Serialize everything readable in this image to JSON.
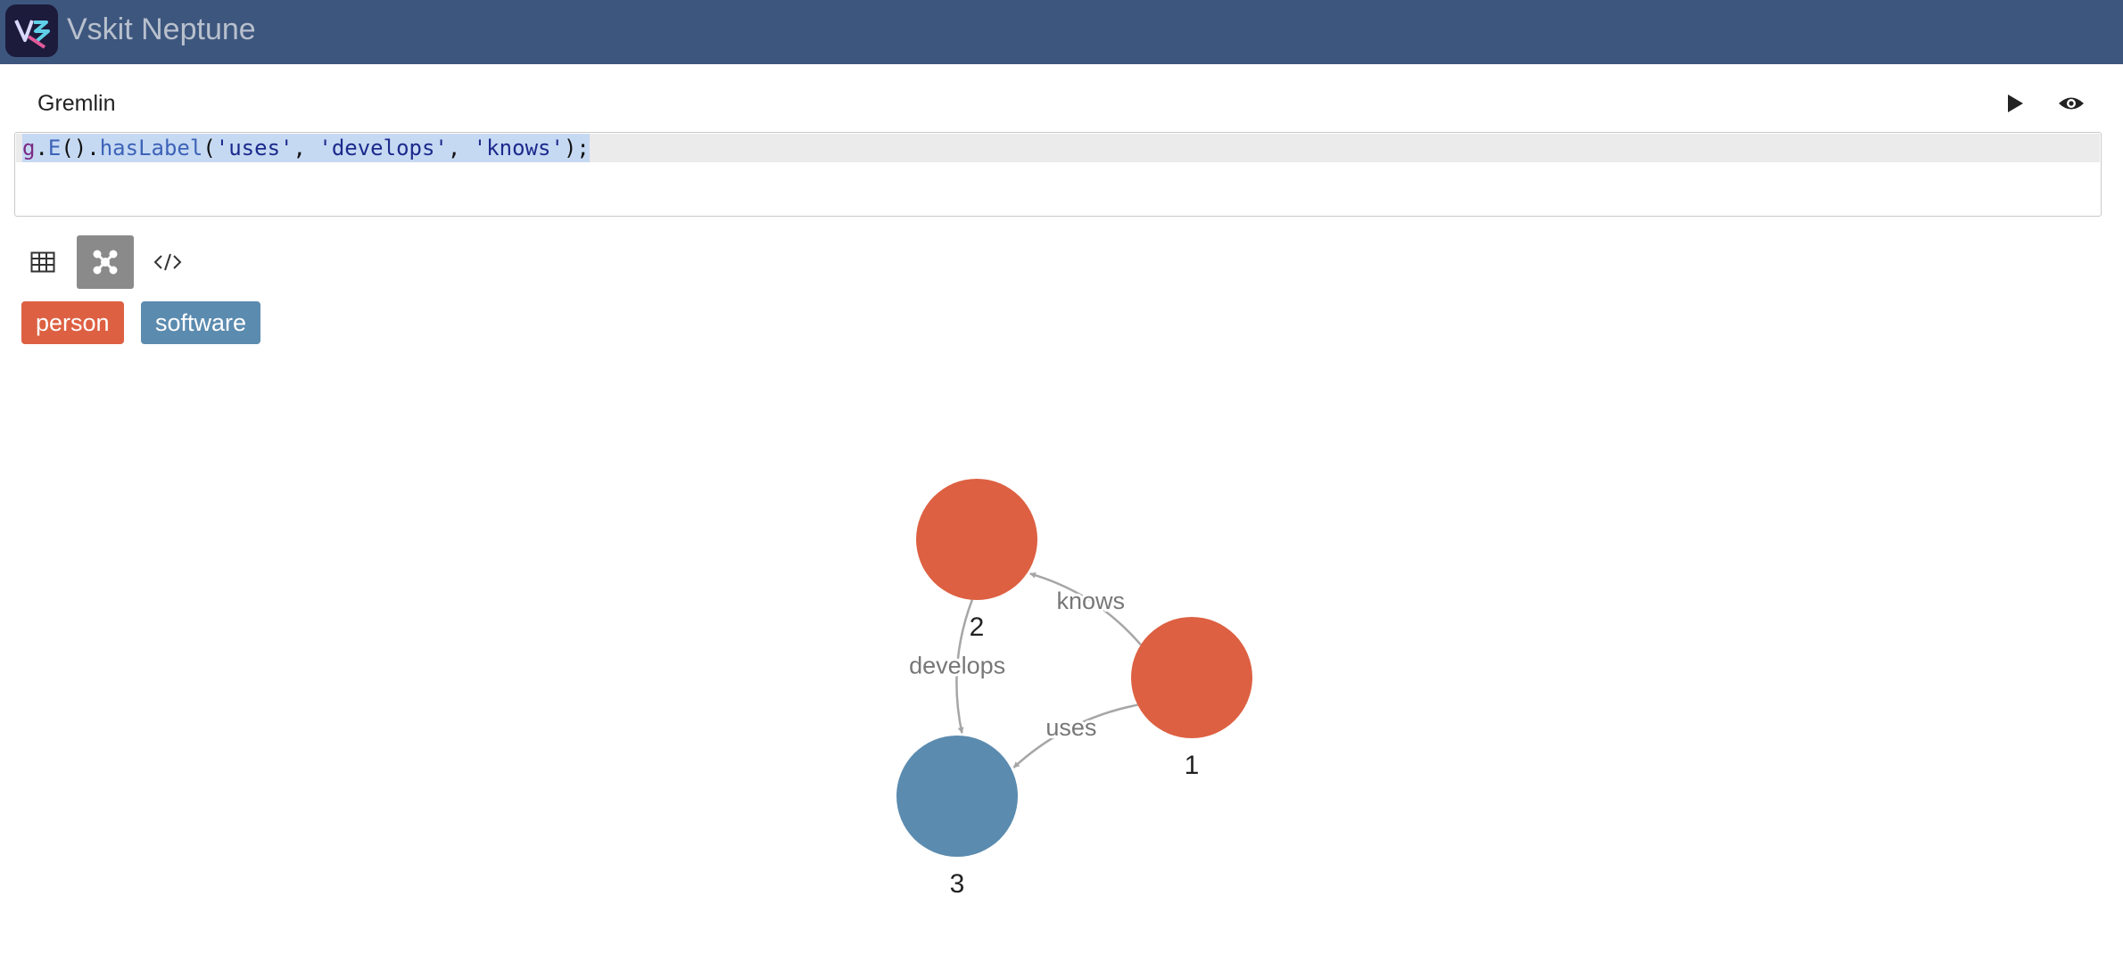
{
  "app": {
    "title": "Vskit Neptune"
  },
  "query": {
    "section_title": "Gremlin",
    "tokens": [
      {
        "text": "g",
        "kind": "var"
      },
      {
        "text": ".",
        "kind": "plain"
      },
      {
        "text": "E",
        "kind": "fn"
      },
      {
        "text": "().",
        "kind": "plain"
      },
      {
        "text": "hasLabel",
        "kind": "fn"
      },
      {
        "text": "(",
        "kind": "plain"
      },
      {
        "text": "'uses'",
        "kind": "str"
      },
      {
        "text": ", ",
        "kind": "plain"
      },
      {
        "text": "'develops'",
        "kind": "str"
      },
      {
        "text": ", ",
        "kind": "plain"
      },
      {
        "text": "'knows'",
        "kind": "str"
      },
      {
        "text": ");",
        "kind": "plain"
      }
    ]
  },
  "toolbar": {
    "run_icon": "play-icon",
    "preview_icon": "eye-icon",
    "views": [
      {
        "name": "table-view",
        "icon": "table-icon",
        "active": false
      },
      {
        "name": "graph-view",
        "icon": "graph-icon",
        "active": true
      },
      {
        "name": "code-view",
        "icon": "code-icon",
        "active": false
      }
    ]
  },
  "legend": [
    {
      "label": "person",
      "color": "#dd6042"
    },
    {
      "label": "software",
      "color": "#5b8baf"
    }
  ],
  "graph": {
    "nodes": [
      {
        "id": "1",
        "label": "1",
        "group": "person"
      },
      {
        "id": "2",
        "label": "2",
        "group": "person"
      },
      {
        "id": "3",
        "label": "3",
        "group": "software"
      }
    ],
    "edges": [
      {
        "from": "1",
        "to": "2",
        "label": "knows"
      },
      {
        "from": "2",
        "to": "3",
        "label": "develops"
      },
      {
        "from": "1",
        "to": "3",
        "label": "uses"
      }
    ],
    "edge_color": "#a6a6a6",
    "edge_label_color": "#777777",
    "node_label_color": "#222222"
  }
}
